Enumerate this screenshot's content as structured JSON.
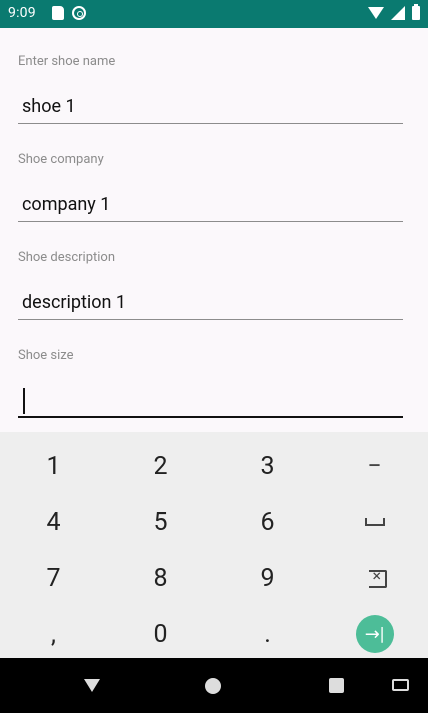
{
  "status_bar": {
    "time": "9:09",
    "left_icons": [
      "sd-card-icon",
      "data-saver-icon"
    ],
    "right_icons": [
      "wifi-icon",
      "signal-icon",
      "battery-icon"
    ]
  },
  "form": {
    "fields": [
      {
        "label": "Enter shoe name",
        "value": "shoe 1"
      },
      {
        "label": "Shoe company",
        "value": "company 1"
      },
      {
        "label": "Shoe description",
        "value": "description 1"
      },
      {
        "label": "Shoe size",
        "value": ""
      }
    ]
  },
  "keyboard": {
    "rows": [
      [
        "1",
        "2",
        "3",
        "−"
      ],
      [
        "4",
        "5",
        "6",
        "space"
      ],
      [
        "7",
        "8",
        "9",
        "backspace"
      ],
      [
        ",",
        "0",
        ".",
        "next"
      ]
    ]
  },
  "nav_bar": {
    "buttons": [
      "back-icon",
      "home-icon",
      "recents-icon",
      "keyboard-icon"
    ]
  },
  "colors": {
    "status_bar": "#0a7a70",
    "background": "#fbf8fb",
    "keyboard": "#eeeeee",
    "accent": "#4dbd98"
  }
}
